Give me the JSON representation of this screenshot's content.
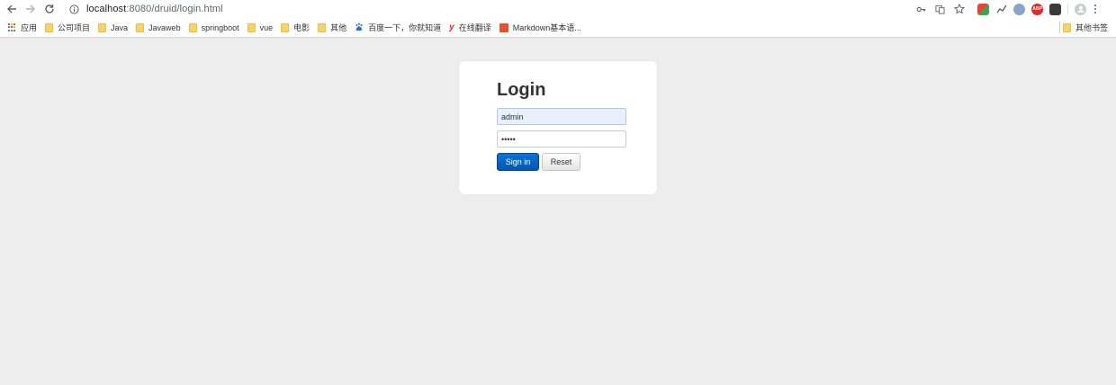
{
  "browser": {
    "url_host": "localhost",
    "url_rest": ":8080/druid/login.html",
    "icons": [
      "back-icon",
      "forward-icon",
      "reload-icon",
      "info-icon",
      "key-icon",
      "translate-icon",
      "star-icon",
      "profile-icon",
      "menu-icon"
    ]
  },
  "bookmarks": {
    "items": [
      {
        "label": "应用",
        "icon": "apps-grid-icon"
      },
      {
        "label": "公司项目",
        "icon": "folder-icon"
      },
      {
        "label": "Java",
        "icon": "folder-icon"
      },
      {
        "label": "Javaweb",
        "icon": "folder-icon"
      },
      {
        "label": "springboot",
        "icon": "folder-icon"
      },
      {
        "label": "vue",
        "icon": "folder-icon"
      },
      {
        "label": "电影",
        "icon": "folder-icon"
      },
      {
        "label": "其他",
        "icon": "folder-icon"
      },
      {
        "label": "百度一下，你就知道",
        "icon": "baidu-icon"
      },
      {
        "label": "在线翻译",
        "icon": "youdao-icon"
      },
      {
        "label": "Markdown基本语...",
        "icon": "markdown-icon"
      }
    ],
    "other_label": "其他书签"
  },
  "login": {
    "title": "Login",
    "username_value": "admin",
    "password_value": "•••••",
    "signin_label": "Sign in",
    "reset_label": "Reset"
  },
  "colors": {
    "page_bg": "#ededed",
    "primary_button": "#0563c1",
    "autofill_bg": "#e8f0fe"
  }
}
